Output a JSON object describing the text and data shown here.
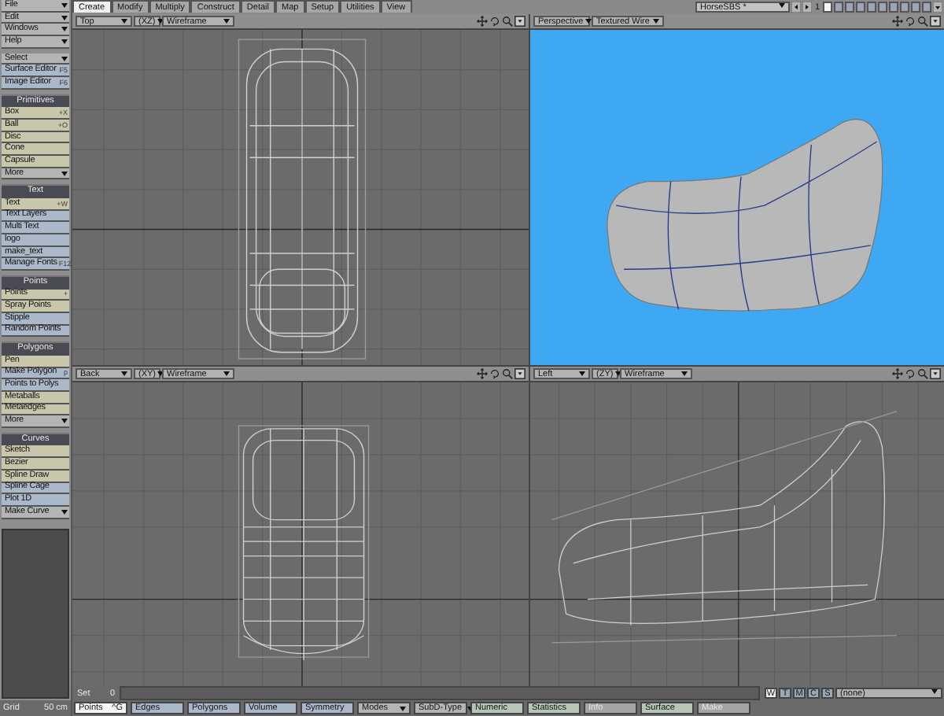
{
  "tabs": [
    {
      "label": "Create",
      "selected": true
    },
    {
      "label": "Modify",
      "selected": false
    },
    {
      "label": "Multiply",
      "selected": false
    },
    {
      "label": "Construct",
      "selected": false
    },
    {
      "label": "Detail",
      "selected": false
    },
    {
      "label": "Map",
      "selected": false
    },
    {
      "label": "Setup",
      "selected": false
    },
    {
      "label": "Utilities",
      "selected": false
    },
    {
      "label": "View",
      "selected": false
    }
  ],
  "object_menu": "HorseSBS *",
  "layer_bank": "1",
  "layers": [
    {
      "selected": true
    },
    {
      "selected": false
    },
    {
      "selected": false
    },
    {
      "selected": false
    },
    {
      "selected": false
    },
    {
      "selected": false
    },
    {
      "selected": false
    },
    {
      "selected": false
    },
    {
      "selected": false
    },
    {
      "selected": false
    }
  ],
  "sidebar": [
    {
      "items": [
        {
          "label": "File",
          "kind": "menu"
        },
        {
          "label": "Edit",
          "kind": "menu"
        },
        {
          "label": "Windows",
          "kind": "menu"
        },
        {
          "label": "Help",
          "kind": "menu"
        }
      ]
    },
    {
      "items": [
        {
          "label": "Select",
          "kind": "menu"
        },
        {
          "label": "Surface Editor",
          "kind": "command",
          "shortcut": "F5"
        },
        {
          "label": "Image Editor",
          "kind": "command",
          "shortcut": "F6"
        }
      ]
    },
    {
      "title": "Primitives",
      "items": [
        {
          "label": "Box",
          "kind": "tool",
          "shortcut": "+X"
        },
        {
          "label": "Ball",
          "kind": "tool",
          "shortcut": "+O"
        },
        {
          "label": "Disc",
          "kind": "tool"
        },
        {
          "label": "Cone",
          "kind": "tool"
        },
        {
          "label": "Capsule",
          "kind": "tool"
        },
        {
          "label": "More",
          "kind": "menu"
        }
      ]
    },
    {
      "title": "Text",
      "items": [
        {
          "label": "Text",
          "kind": "tool",
          "shortcut": "+W"
        },
        {
          "label": "Text Layers",
          "kind": "command"
        },
        {
          "label": "Multi Text",
          "kind": "command"
        },
        {
          "label": "logo",
          "kind": "command"
        },
        {
          "label": "make_text",
          "kind": "command"
        },
        {
          "label": "Manage Fonts",
          "kind": "command",
          "shortcut": "F12"
        }
      ]
    },
    {
      "title": "Points",
      "items": [
        {
          "label": "Points",
          "kind": "tool",
          "shortcut": "+"
        },
        {
          "label": "Spray Points",
          "kind": "tool"
        },
        {
          "label": "Stipple",
          "kind": "command"
        },
        {
          "label": "Random Points",
          "kind": "command"
        }
      ]
    },
    {
      "title": "Polygons",
      "items": [
        {
          "label": "Pen",
          "kind": "tool"
        },
        {
          "label": "Make Polygon",
          "kind": "command",
          "shortcut": "p"
        },
        {
          "label": "Points to Polys",
          "kind": "command"
        },
        {
          "label": "Metaballs",
          "kind": "tool"
        },
        {
          "label": "Metaedges",
          "kind": "tool"
        },
        {
          "label": "More",
          "kind": "menu"
        }
      ]
    },
    {
      "title": "Curves",
      "items": [
        {
          "label": "Sketch",
          "kind": "tool"
        },
        {
          "label": "Bezier",
          "kind": "tool"
        },
        {
          "label": "Spline Draw",
          "kind": "tool"
        },
        {
          "label": "Spline Cage",
          "kind": "command"
        },
        {
          "label": "Plot 1D",
          "kind": "command"
        },
        {
          "label": "Make Curve",
          "kind": "menu"
        }
      ]
    }
  ],
  "viewports": [
    {
      "view": "Top",
      "axes": "(XZ)",
      "mode": "Wireframe",
      "kind": "top"
    },
    {
      "view": "Perspective",
      "mode": "Textured Wire",
      "kind": "perspective"
    },
    {
      "view": "Back",
      "axes": "(XY)",
      "mode": "Wireframe",
      "kind": "back"
    },
    {
      "view": "Left",
      "axes": "(ZY)",
      "mode": "Wireframe",
      "kind": "left"
    }
  ],
  "set_row": {
    "label": "Set",
    "value": "0"
  },
  "toggles": [
    {
      "label": "W",
      "selected": true
    },
    {
      "label": "T",
      "selected": false
    },
    {
      "label": "M",
      "selected": false
    },
    {
      "label": "C",
      "selected": false
    },
    {
      "label": "S",
      "selected": false
    }
  ],
  "surface_menu": "(none)",
  "grid": {
    "label": "Grid",
    "value": "50 cm"
  },
  "bottom_buttons": [
    {
      "label": "Points",
      "shortcut": "^G",
      "kind": "mode",
      "selected": true,
      "disabled": false
    },
    {
      "label": "Edges",
      "kind": "mode",
      "selected": false,
      "disabled": false
    },
    {
      "label": "Polygons",
      "kind": "mode",
      "selected": false,
      "disabled": false
    },
    {
      "label": "Volume",
      "kind": "mode",
      "selected": false,
      "disabled": false
    },
    {
      "label": "Symmetry",
      "kind": "mode",
      "selected": false,
      "disabled": false
    },
    {
      "label": "Modes",
      "kind": "menu",
      "selected": false,
      "disabled": false
    },
    {
      "label": "SubD-Type",
      "kind": "menu",
      "selected": false,
      "disabled": false
    },
    {
      "label": "Numeric",
      "kind": "command",
      "selected": false,
      "disabled": false
    },
    {
      "label": "Statistics",
      "kind": "command",
      "selected": false,
      "disabled": false
    },
    {
      "label": "Info",
      "kind": "command",
      "selected": false,
      "disabled": true
    },
    {
      "label": "Surface",
      "kind": "command",
      "selected": false,
      "disabled": false
    },
    {
      "label": "Make",
      "kind": "command",
      "selected": false,
      "disabled": true
    }
  ]
}
